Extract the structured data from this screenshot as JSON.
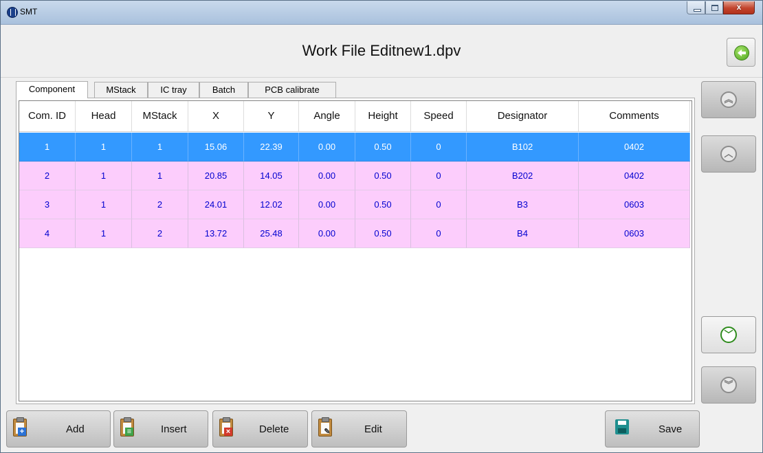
{
  "window": {
    "title": "SMT",
    "close_glyph": "x"
  },
  "header": {
    "title": "Work File Editnew1.dpv",
    "back_icon": "back-arrow-icon"
  },
  "tabs": [
    {
      "label": "Component",
      "active": true
    },
    {
      "label": "MStack",
      "active": false
    },
    {
      "label": "IC tray",
      "active": false
    },
    {
      "label": "Batch",
      "active": false
    },
    {
      "label": "PCB calibrate",
      "active": false
    }
  ],
  "table": {
    "columns": [
      "Com. ID",
      "Head",
      "MStack",
      "X",
      "Y",
      "Angle",
      "Height",
      "Speed",
      "Designator",
      "Comments"
    ],
    "rows": [
      {
        "selected": true,
        "cells": [
          "1",
          "1",
          "1",
          "15.06",
          "22.39",
          "0.00",
          "0.50",
          "0",
          "B102",
          "0402"
        ]
      },
      {
        "selected": false,
        "cells": [
          "2",
          "1",
          "1",
          "20.85",
          "14.05",
          "0.00",
          "0.50",
          "0",
          "B202",
          "0402"
        ]
      },
      {
        "selected": false,
        "cells": [
          "3",
          "1",
          "2",
          "24.01",
          "12.02",
          "0.00",
          "0.50",
          "0",
          "B3",
          "0603"
        ]
      },
      {
        "selected": false,
        "cells": [
          "4",
          "1",
          "2",
          "13.72",
          "25.48",
          "0.00",
          "0.50",
          "0",
          "B4",
          "0603"
        ]
      }
    ]
  },
  "side_buttons": {
    "page_up": {
      "icon": "double-chevron-up-icon",
      "glyph": "︽"
    },
    "row_up": {
      "icon": "chevron-up-icon",
      "glyph": "︿"
    },
    "row_down": {
      "icon": "chevron-down-icon",
      "glyph": "﹀"
    },
    "page_down": {
      "icon": "double-chevron-down-icon",
      "glyph": "︾"
    }
  },
  "toolbar": {
    "add_label": "Add",
    "insert_label": "Insert",
    "delete_label": "Delete",
    "edit_label": "Edit",
    "save_label": "Save"
  },
  "colors": {
    "selected_row": "#3399ff",
    "row_background": "#fccdfc",
    "row_text": "#0000d0",
    "accent_green": "#2e8b1c"
  }
}
